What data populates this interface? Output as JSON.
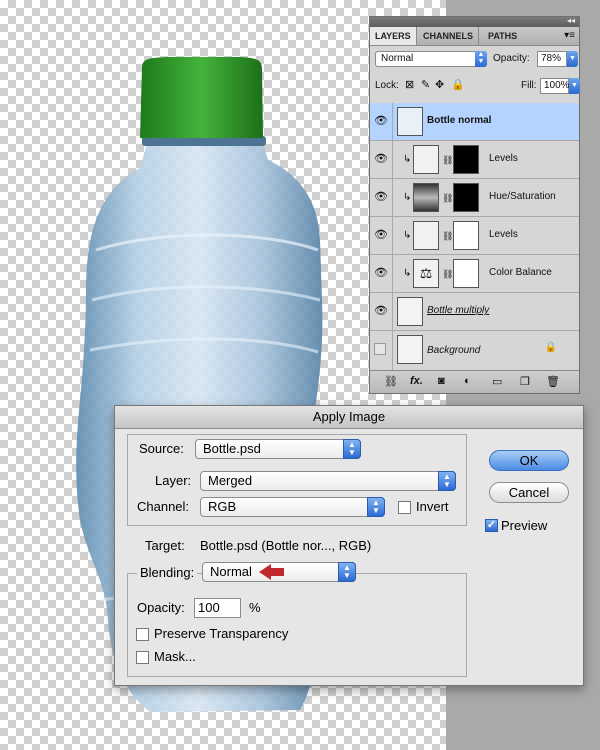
{
  "layers_panel": {
    "tabs": [
      "LAYERS",
      "CHANNELS",
      "PATHS"
    ],
    "blend_mode": "Normal",
    "opacity_label": "Opacity:",
    "opacity_value": "78%",
    "lock_label": "Lock:",
    "fill_label": "Fill:",
    "fill_value": "100%",
    "layers": [
      {
        "name": "Bottle normal",
        "visible": true,
        "selected": true
      },
      {
        "name": "Levels",
        "visible": true
      },
      {
        "name": "Hue/Saturation",
        "visible": true
      },
      {
        "name": "Levels",
        "visible": true
      },
      {
        "name": "Color Balance",
        "visible": true
      },
      {
        "name": "Bottle multiply",
        "visible": true
      },
      {
        "name": "Background",
        "visible": false
      }
    ],
    "bottom_bar_icons": [
      "link-icon",
      "fx-icon",
      "mask-icon",
      "adjustment-icon",
      "folder-icon",
      "new-layer-icon",
      "trash-icon"
    ]
  },
  "dialog": {
    "title": "Apply Image",
    "source_label": "Source:",
    "source_value": "Bottle.psd",
    "layer_label": "Layer:",
    "layer_value": "Merged",
    "channel_label": "Channel:",
    "channel_value": "RGB",
    "invert_label": "Invert",
    "invert_checked": false,
    "target_label": "Target:",
    "target_value": "Bottle.psd (Bottle nor..., RGB)",
    "blending_label": "Blending:",
    "blending_value": "Normal",
    "opacity_label": "Opacity:",
    "opacity_value": "100",
    "opacity_unit": "%",
    "preserve_transparency_label": "Preserve Transparency",
    "preserve_transparency_checked": false,
    "mask_label": "Mask...",
    "mask_checked": false,
    "ok_label": "OK",
    "cancel_label": "Cancel",
    "preview_label": "Preview",
    "preview_checked": true
  },
  "colors": {
    "cap_green": "#2f9a2a",
    "selection_blue": "#b5d3ff",
    "accent_blue": "#2c6ad2",
    "arrow_red": "#c0282b"
  }
}
